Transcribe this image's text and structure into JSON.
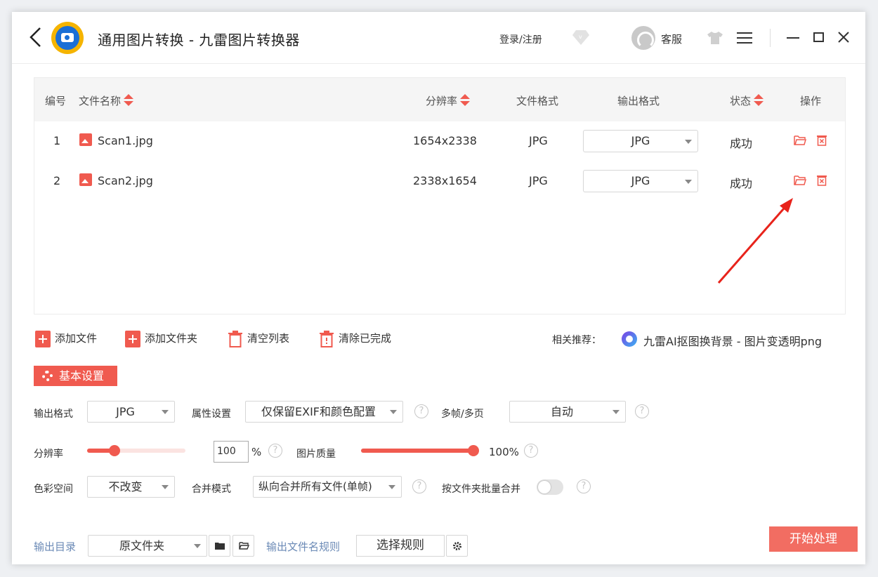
{
  "app": {
    "title": "通用图片转换 - 九雷图片转换器",
    "login": "登录/注册",
    "service": "客服"
  },
  "table": {
    "headers": {
      "index": "编号",
      "name": "文件名称",
      "resolution": "分辨率",
      "format": "文件格式",
      "output": "输出格式",
      "status": "状态",
      "action": "操作"
    },
    "rows": [
      {
        "index": "1",
        "name": "Scan1.jpg",
        "resolution": "1654x2338",
        "format": "JPG",
        "output": "JPG",
        "status": "成功"
      },
      {
        "index": "2",
        "name": "Scan2.jpg",
        "resolution": "2338x1654",
        "format": "JPG",
        "output": "JPG",
        "status": "成功"
      }
    ]
  },
  "toolbar": {
    "add_file": "添加文件",
    "add_folder": "添加文件夹",
    "clear_list": "清空列表",
    "clear_done": "清除已完成"
  },
  "recommend": {
    "label": "相关推荐：",
    "text": "九雷AI抠图换背景 - 图片变透明png"
  },
  "settings": {
    "tab": "基本设置",
    "output_format_label": "输出格式",
    "output_format": "JPG",
    "attr_label": "属性设置",
    "attr": "仅保留EXIF和颜色配置",
    "multipage_label": "多帧/多页",
    "multipage": "自动",
    "resolution_label": "分辨率",
    "resolution_value": "100",
    "resolution_unit": "%",
    "resolution_fraction": 0.28,
    "quality_label": "图片质量",
    "quality_value": "100%",
    "quality_fraction": 1.0,
    "color_label": "色彩空间",
    "color": "不改变",
    "merge_label": "合并模式",
    "merge": "纵向合并所有文件(单帧)",
    "batch_merge_label": "按文件夹批量合并",
    "help": "?"
  },
  "bottom": {
    "output_dir_label": "输出目录",
    "output_dir": "原文件夹",
    "rule_label": "输出文件名规则",
    "rule_button": "选择规则",
    "start": "开始处理"
  },
  "colors": {
    "accent": "#f05a4f",
    "arrow": "#e8231b",
    "link": "#6b8ab6"
  }
}
